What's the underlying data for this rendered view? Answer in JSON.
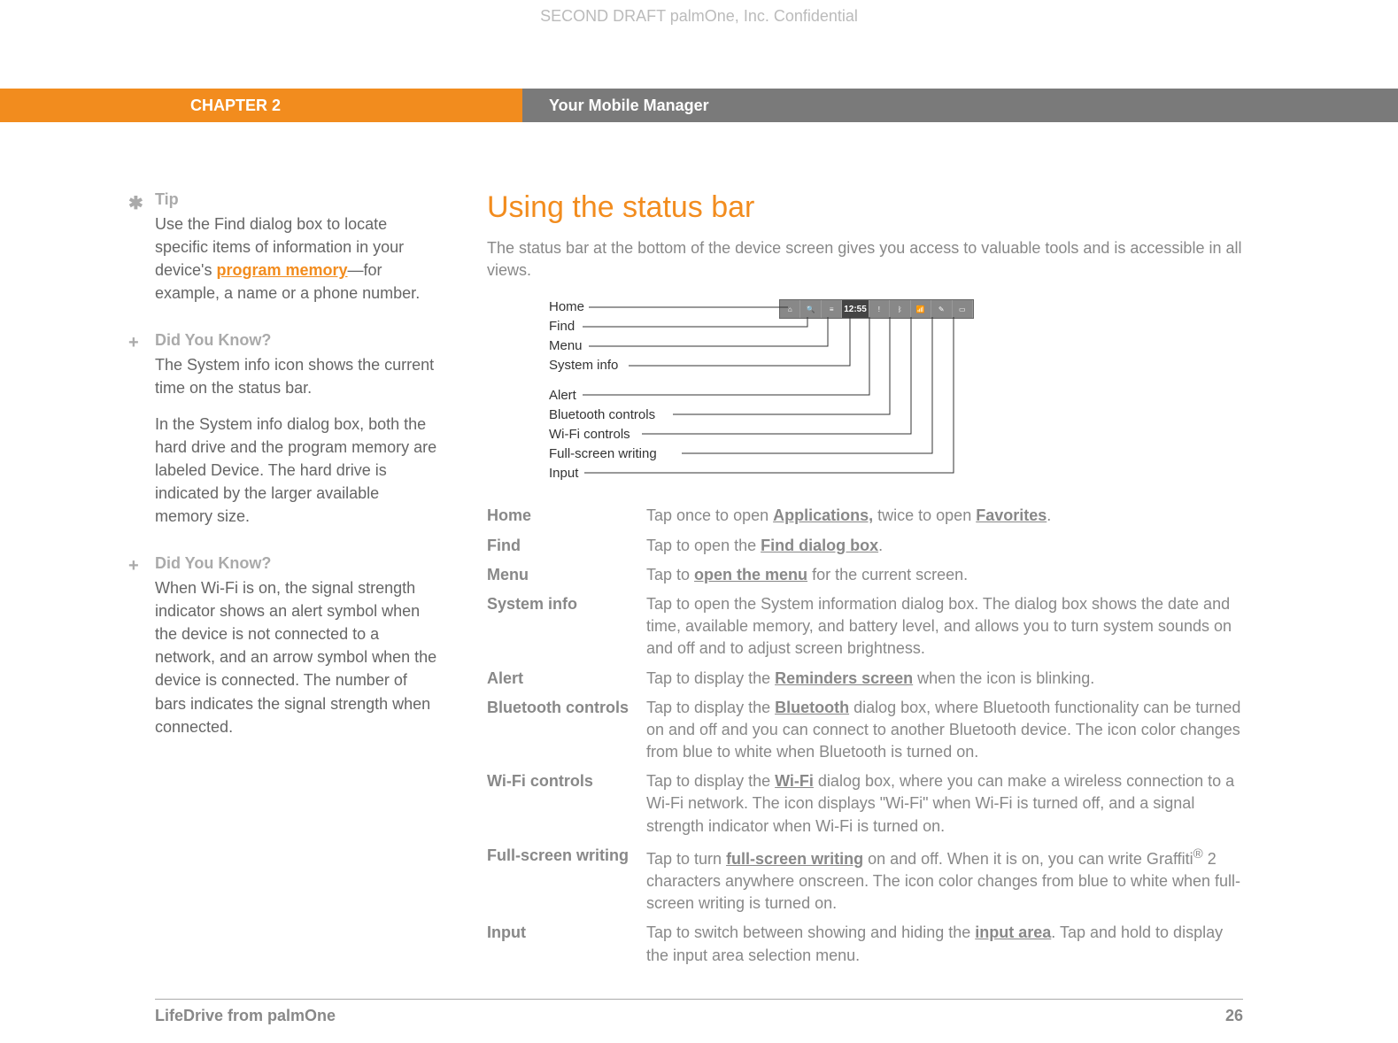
{
  "watermark": "SECOND DRAFT palmOne, Inc.  Confidential",
  "chapter": "CHAPTER 2",
  "page_title": "Your Mobile Manager",
  "sidebar": {
    "tip": {
      "heading": "Tip",
      "text_before": "Use the Find dialog box to locate specific items of information in your device's ",
      "link": "program memory",
      "text_after": "—for example, a name or a phone number."
    },
    "dyk1": {
      "heading": "Did You Know?",
      "p1": "The System info icon shows the current time on the status bar.",
      "p2": "In the System info dialog box, both the hard drive and the program memory are labeled Device. The hard drive is indicated by the larger available memory size."
    },
    "dyk2": {
      "heading": "Did You Know?",
      "p1": "When Wi-Fi is on, the signal strength indicator shows an alert symbol when the device is not connected to a network, and an arrow symbol when the device is connected. The number of bars indicates the signal strength when connected."
    }
  },
  "main": {
    "title": "Using the status bar",
    "intro": "The status bar at the bottom of the device screen gives you access to valuable tools and is accessible in all views.",
    "callouts": [
      "Home",
      "Find",
      "Menu",
      "System info",
      "Alert",
      "Bluetooth controls",
      "Wi-Fi controls",
      "Full-screen writing",
      "Input"
    ],
    "status_clock": "12:55",
    "defs": {
      "home": {
        "term": "Home",
        "t1": "Tap once to open ",
        "l1": "Applications,",
        "t2": " twice to open ",
        "l2": "Favorites",
        "t3": "."
      },
      "find": {
        "term": "Find",
        "t1": "Tap to open the ",
        "l1": "Find dialog box",
        "t2": "."
      },
      "menu": {
        "term": "Menu",
        "t1": "Tap to ",
        "l1": "open the menu",
        "t2": " for the current screen."
      },
      "sysinfo": {
        "term": "System info",
        "t1": "Tap to open the System information dialog box. The dialog box shows the date and time, available memory, and battery level, and allows you to turn system sounds on and off and to adjust screen brightness."
      },
      "alert": {
        "term": "Alert",
        "t1": "Tap to display the ",
        "l1": "Reminders screen",
        "t2": " when the icon is blinking."
      },
      "bt": {
        "term": "Bluetooth controls",
        "t1": "Tap to display the ",
        "l1": "Bluetooth",
        "t2": " dialog box, where Bluetooth functionality can be turned on and off and you can connect to another Bluetooth device. The icon color changes from blue to white when Bluetooth is turned on."
      },
      "wifi": {
        "term": "Wi-Fi controls",
        "t1": "Tap to display the ",
        "l1": "Wi-Fi",
        "t2": " dialog box, where you can make a wireless connection to a Wi-Fi network. The icon displays \"Wi-Fi\" when Wi-Fi is turned off, and a signal strength indicator when Wi-Fi is turned on."
      },
      "fsw": {
        "term": "Full-screen writing",
        "t1": "Tap to turn ",
        "l1": "full-screen writing",
        "t2": " on and off. When it is on, you can write Graffiti",
        "sup": "®",
        "t3": " 2 characters anywhere onscreen. The icon color changes from blue to white when full-screen writing is turned on."
      },
      "input": {
        "term": "Input",
        "t1": "Tap to switch between showing and hiding the ",
        "l1": "input area",
        "t2": ". Tap and hold to display the input area selection menu."
      }
    }
  },
  "footer": {
    "left": "LifeDrive from palmOne",
    "right": "26"
  }
}
